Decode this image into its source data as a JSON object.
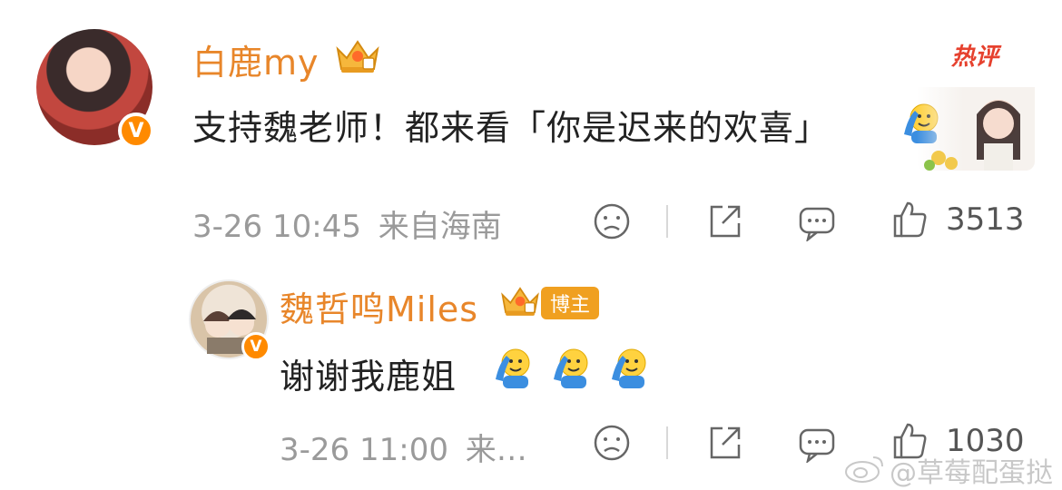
{
  "comment": {
    "username": "白鹿my",
    "hot_label": "热评",
    "text": "支持魏老师！都来看「你是迟来的欢喜」",
    "date": "3-26",
    "time": "10:45",
    "location": "来自海南",
    "like_count": "3513",
    "verified_mark": "V",
    "emoji": "salute-emoji"
  },
  "reply": {
    "username": "魏哲鸣Miles",
    "tag": "博主",
    "text": "谢谢我鹿姐",
    "date": "3-26",
    "time": "11:00",
    "location_truncated": "来…",
    "like_count": "1030",
    "verified_mark": "V",
    "emojis": [
      "salute-emoji",
      "salute-emoji",
      "salute-emoji"
    ]
  },
  "watermark": "@草莓配蛋挞",
  "colors": {
    "username": "#e8862a",
    "hot": "#e6412e",
    "meta": "#9a9a9a",
    "badge": "#ff8a00"
  }
}
